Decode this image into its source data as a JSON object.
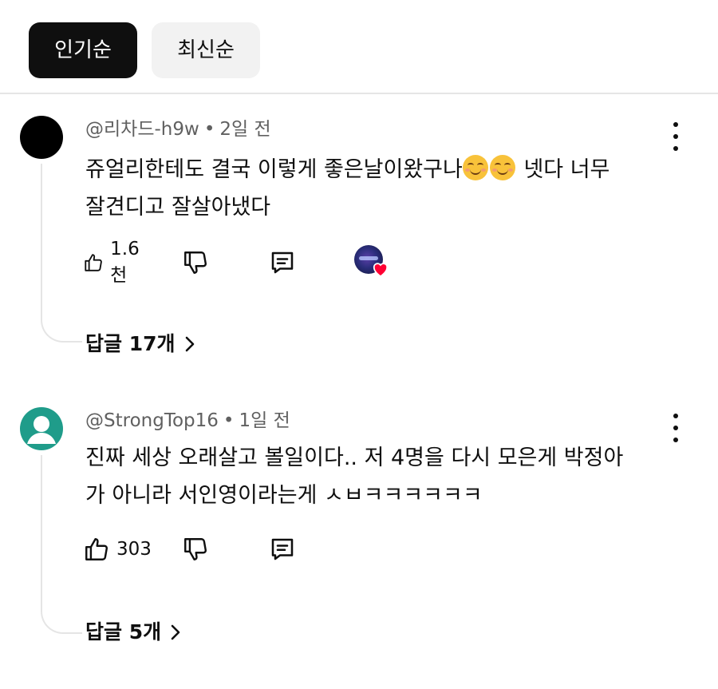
{
  "sort_chips": {
    "popular": "인기순",
    "newest": "최신순"
  },
  "comments": [
    {
      "author": "@리차드-h9w",
      "separator": "•",
      "time": "2일 전",
      "avatar_color": "#000000",
      "text_line1_a": "쥬얼리한테도 결국 이렇게 좋은날이왔구나",
      "emoji": "smiling-face-icon",
      "text_line1_b": " 넷다 너무",
      "text_line2": "잘견디고 잘살아냈다",
      "like_count": "1.6천",
      "creator_heart": true,
      "replies_label": "답글 17개"
    },
    {
      "author": "@StrongTop16",
      "separator": "•",
      "time": "1일 전",
      "avatar_color": "#1f9c8a",
      "text_line1": "진짜 세상 오래살고 볼일이다.. 저 4명을 다시 모은게 박정아",
      "text_line2": "가 아니라 서인영이라는게 ㅅㅂㅋㅋㅋㅋㅋㅋ",
      "like_count": "303",
      "creator_heart": false,
      "replies_label": "답글 5개"
    }
  ]
}
